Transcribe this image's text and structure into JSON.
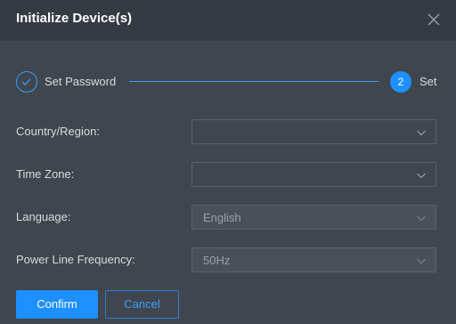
{
  "dialog": {
    "title": "Initialize Device(s)",
    "close_icon": "close-icon"
  },
  "stepper": {
    "step1": {
      "label": "Set Password",
      "state": "completed",
      "icon": "check-icon"
    },
    "step2": {
      "number": "2",
      "label": "Set",
      "state": "active"
    },
    "accent_color": "#1e90ff"
  },
  "form": {
    "country_region": {
      "label": "Country/Region:",
      "value": ""
    },
    "time_zone": {
      "label": "Time Zone:",
      "value": ""
    },
    "language": {
      "label": "Language:",
      "value": "English",
      "disabled": true
    },
    "power_line_frequency": {
      "label": "Power Line Frequency:",
      "value": "50Hz",
      "disabled": true
    }
  },
  "buttons": {
    "confirm": "Confirm",
    "cancel": "Cancel"
  }
}
